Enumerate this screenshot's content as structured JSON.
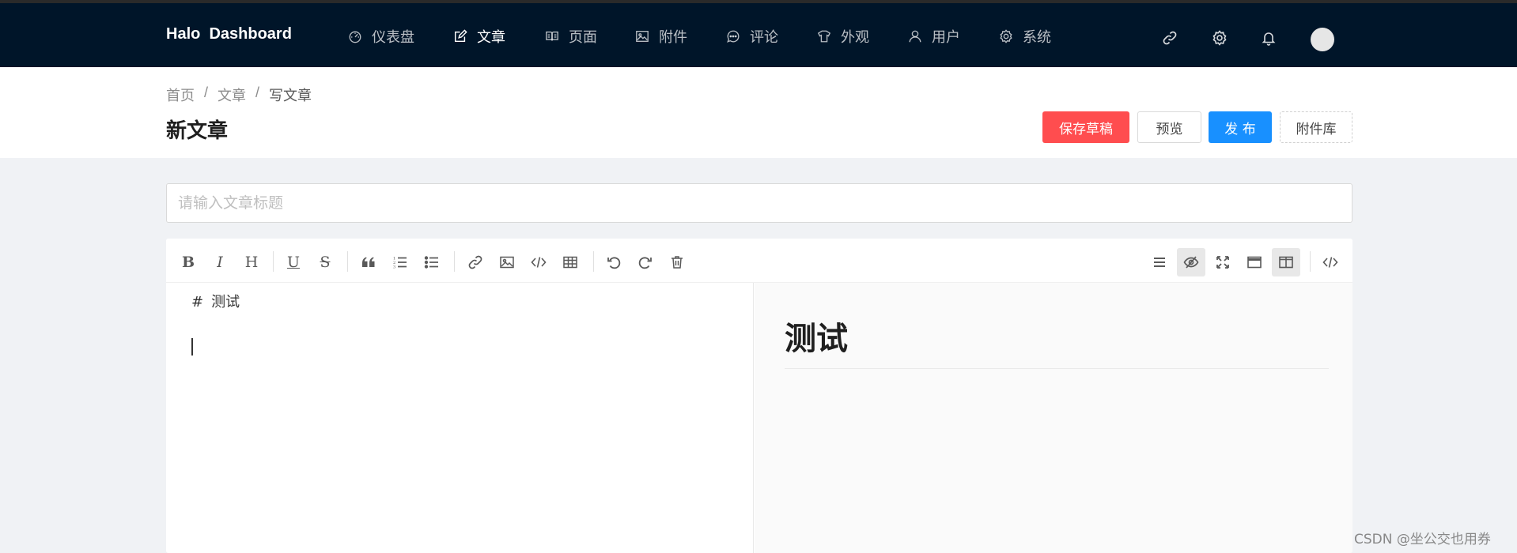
{
  "app": {
    "brand": "Halo  Dashboard"
  },
  "nav": {
    "items": [
      {
        "label": "仪表盘",
        "icon": "dashboard-icon"
      },
      {
        "label": "文章",
        "icon": "edit-icon",
        "active": true
      },
      {
        "label": "页面",
        "icon": "book-icon"
      },
      {
        "label": "附件",
        "icon": "picture-icon"
      },
      {
        "label": "评论",
        "icon": "message-icon"
      },
      {
        "label": "外观",
        "icon": "skin-icon"
      },
      {
        "label": "用户",
        "icon": "user-icon"
      },
      {
        "label": "系统",
        "icon": "setting-icon"
      }
    ],
    "right_icons": [
      "link-icon",
      "gear-icon",
      "bell-icon",
      "avatar"
    ]
  },
  "breadcrumb": [
    "首页",
    "文章",
    "写文章"
  ],
  "page": {
    "title": "新文章"
  },
  "actions": {
    "save_draft": "保存草稿",
    "preview": "预览",
    "publish": "发 布",
    "attachments": "附件库"
  },
  "title_input": {
    "placeholder": "请输入文章标题",
    "value": ""
  },
  "toolbar": {
    "left": [
      "bold",
      "italic",
      "heading",
      "underline",
      "strikethrough",
      "quote",
      "ordered-list",
      "unordered-list",
      "link",
      "image",
      "code",
      "table",
      "undo",
      "redo",
      "trash"
    ],
    "right": [
      "navigation",
      "preview",
      "fullscreen",
      "fullscreen-edit",
      "subfield",
      "html-code"
    ]
  },
  "editor": {
    "markdown_hash": "#",
    "markdown_text": "测试",
    "preview_h1": "测试"
  },
  "watermark": "CSDN @坐公交也用券",
  "colors": {
    "nav_bg": "#001529",
    "draft": "#ff4d4f",
    "publish": "#1890ff"
  }
}
